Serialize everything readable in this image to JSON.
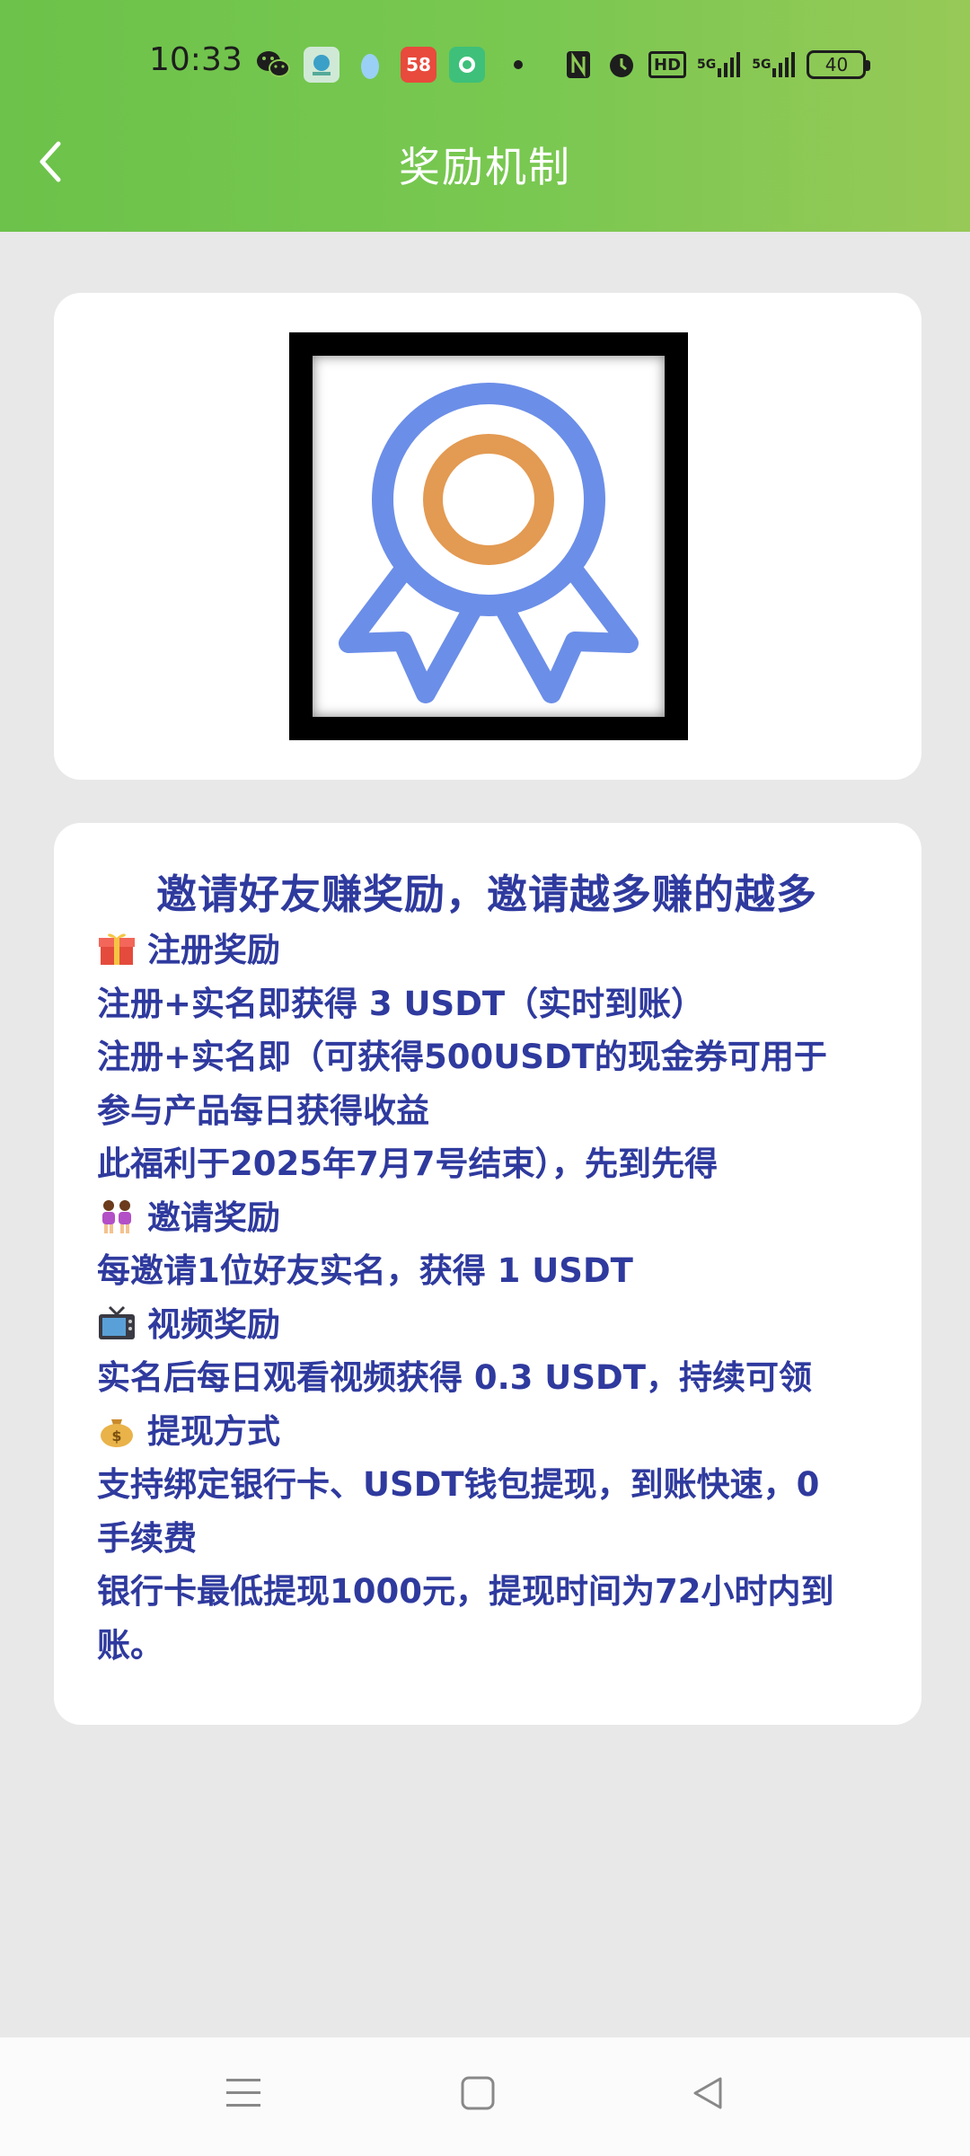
{
  "status_bar": {
    "time": "10:33",
    "badge_58": "58",
    "hd_label": "HD",
    "signal1": "5G",
    "signal2": "5G",
    "battery": "40"
  },
  "header": {
    "title": "奖励机制"
  },
  "card_text": {
    "headline": "邀请好友赚奖励，邀请越多赚的越多",
    "lines": [
      {
        "icon": "gift-icon",
        "text": "注册奖励"
      },
      {
        "icon": "",
        "text": "注册+实名即获得 3 USDT（实时到账）"
      },
      {
        "icon": "",
        "text": "注册+实名即（可获得500USDT的现金券可用于"
      },
      {
        "icon": "",
        "text": "参与产品每日获得收益"
      },
      {
        "icon": "",
        "text": "此福利于2025年7月7号结束），先到先得"
      },
      {
        "icon": "people-icon",
        "text": "邀请奖励"
      },
      {
        "icon": "",
        "text": "每邀请1位好友实名，获得 1 USDT"
      },
      {
        "icon": "tv-icon",
        "text": "视频奖励"
      },
      {
        "icon": "",
        "text": "实名后每日观看视频获得 0.3 USDT，持续可领"
      },
      {
        "icon": "money-bag-icon",
        "text": "提现方式"
      },
      {
        "icon": "",
        "text": "支持绑定银行卡、USDT钱包提现，到账快速，0"
      },
      {
        "icon": "",
        "text": "手续费"
      },
      {
        "icon": "",
        "text": "银行卡最低提现1000元，提现时间为72小时内到"
      },
      {
        "icon": "",
        "text": "账。"
      }
    ]
  },
  "colors": {
    "header_green": "#79c851",
    "text_blue": "#2f3a9e",
    "badge_blue": "#6b8ee8",
    "badge_orange": "#e39a52"
  }
}
